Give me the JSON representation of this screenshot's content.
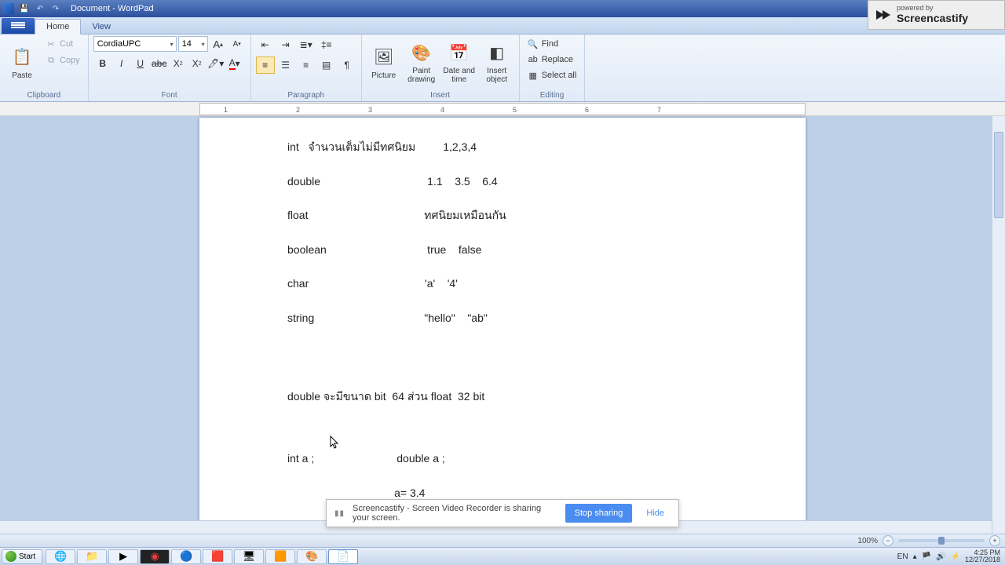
{
  "window": {
    "title": "Document - WordPad"
  },
  "tabs": {
    "home": "Home",
    "view": "View"
  },
  "clipboard": {
    "paste": "Paste",
    "cut": "Cut",
    "copy": "Copy",
    "label": "Clipboard"
  },
  "font": {
    "family": "CordiaUPC",
    "size": "14",
    "label": "Font",
    "grow": "A",
    "shrink": "A"
  },
  "paragraph": {
    "label": "Paragraph"
  },
  "insert": {
    "picture": "Picture",
    "paint": "Paint drawing",
    "datetime": "Date and time",
    "object": "Insert object",
    "label": "Insert"
  },
  "editing": {
    "find": "Find",
    "replace": "Replace",
    "selectall": "Select all",
    "label": "Editing"
  },
  "ruler": {
    "marks": [
      "1",
      "2",
      "3",
      "4",
      "5",
      "6",
      "7"
    ]
  },
  "doc": {
    "l1": "int   จำนวนเต็มไม่มีทศนิยม         1,2,3,4",
    "l2": "double                                   1.1    3.5    6.4",
    "l3": "float                                      ทศนิยมเหมือนกัน",
    "l4": "boolean                                 true    false",
    "l5": "char                                      'a'    '4'",
    "l6": "string                                    \"hello\"    \"ab\"",
    "l7": "double จะมีขนาด bit  64 ส่วน float  32 bit",
    "l8": "int a ;                           double a ;",
    "l9": "                                   a= 3.4"
  },
  "status": {
    "zoom": "100%"
  },
  "taskbar": {
    "start": "Start",
    "lang": "EN",
    "time": "4:25 PM",
    "date": "12/27/2018"
  },
  "share": {
    "msg": "Screencastify - Screen Video Recorder is sharing your screen.",
    "stop": "Stop sharing",
    "hide": "Hide"
  },
  "watermark": {
    "prefix": "powered by",
    "brand": "Screencastify"
  }
}
